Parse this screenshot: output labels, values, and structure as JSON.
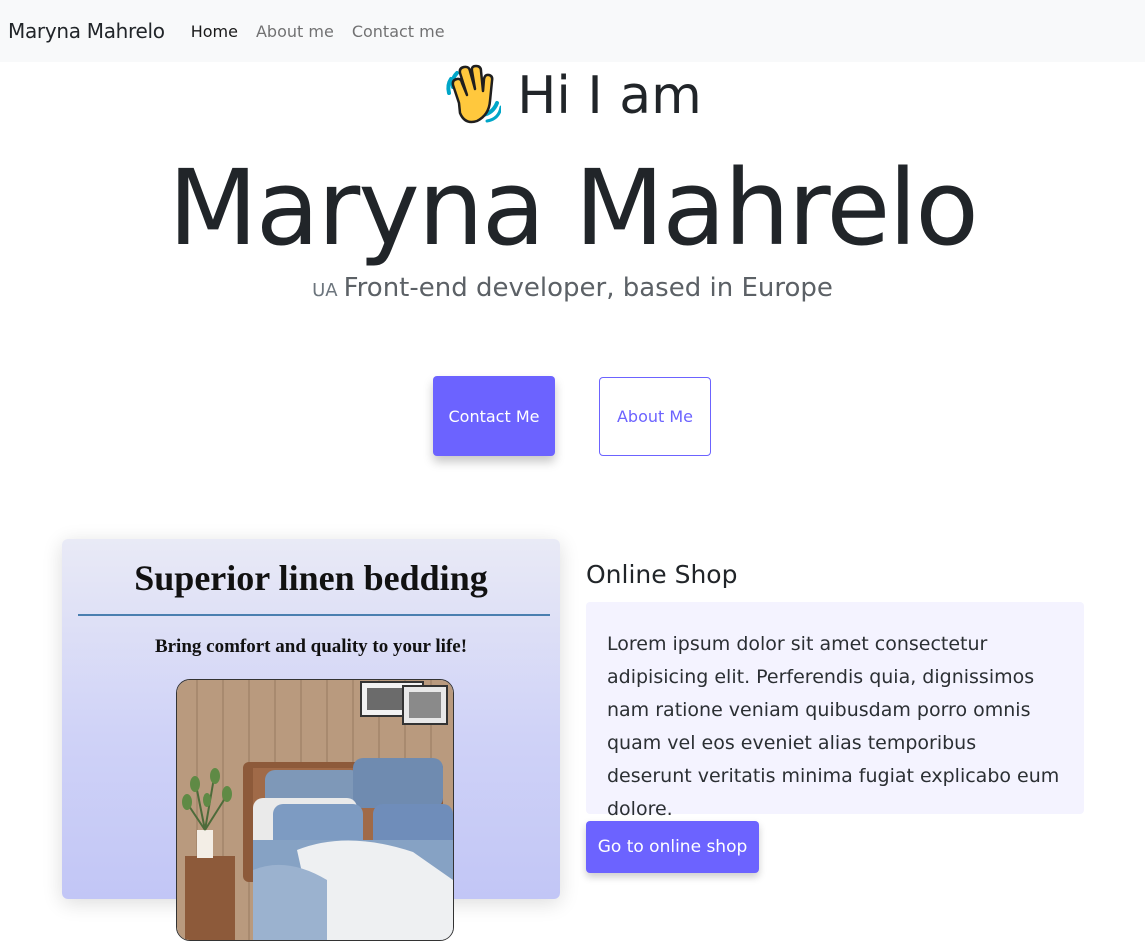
{
  "navbar": {
    "brand": "Maryna Mahrelo",
    "links": [
      {
        "label": "Home",
        "active": true
      },
      {
        "label": "About me",
        "active": false
      },
      {
        "label": "Contact me",
        "active": false
      }
    ]
  },
  "hero": {
    "wave_icon": "waving-hand-icon",
    "greeting": "Hi I am",
    "name": "Maryna Mahrelo",
    "flag": "UA",
    "subtitle": "Front-end developer, based in Europe",
    "primary_button": "Contact Me",
    "secondary_button": "About Me"
  },
  "project": {
    "card_title": "Superior linen bedding",
    "card_subtitle": "Bring comfort and quality to your life!",
    "title": "Online Shop",
    "description": "Lorem ipsum dolor sit amet consectetur adipisicing elit. Perferendis quia, dignissimos nam ratione veniam quibusdam porro omnis quam vel eos eveniet alias temporibus deserunt veritatis minima fugiat explicabo eum dolore.",
    "button": "Go to online shop"
  },
  "colors": {
    "accent": "#6c63ff",
    "navbar_bg": "#f8f9fa",
    "text_panel_bg": "#f4f3ff"
  }
}
